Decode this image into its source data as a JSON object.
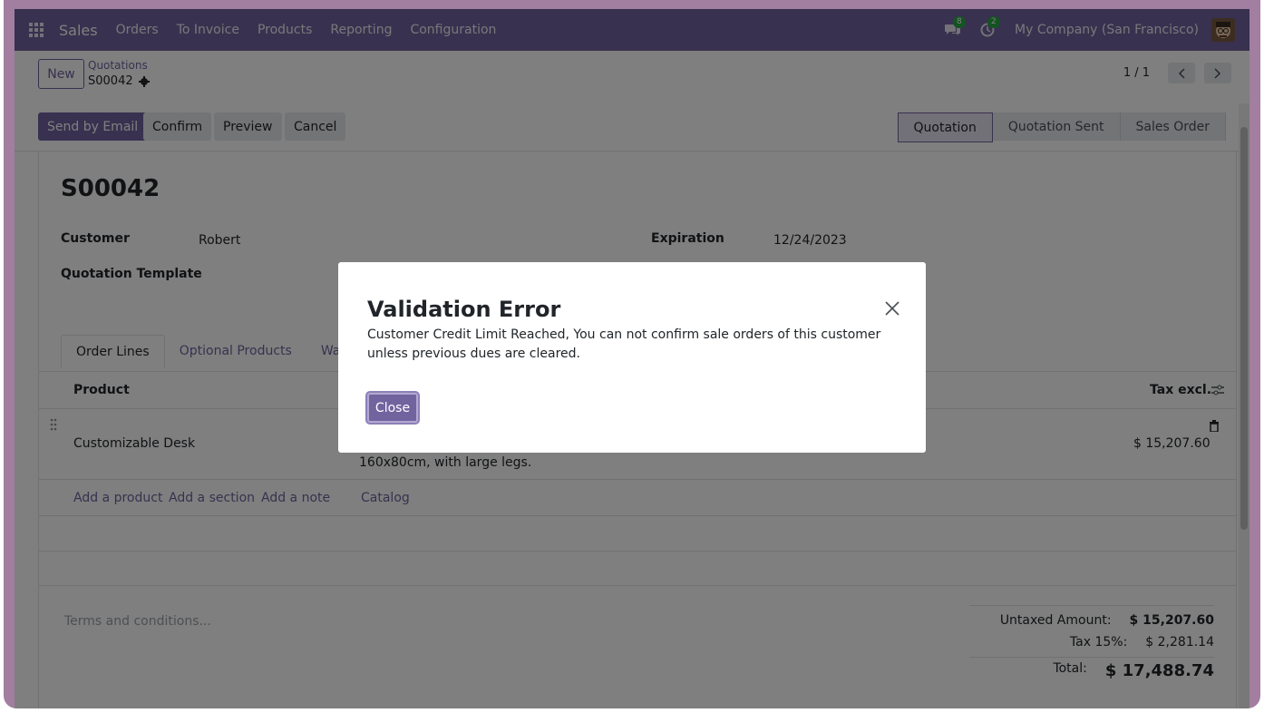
{
  "navbar": {
    "brand": "Sales",
    "menu": [
      "Orders",
      "To Invoice",
      "Products",
      "Reporting",
      "Configuration"
    ],
    "messages_count": "8",
    "activities_count": "2",
    "company": "My Company (San Francisco)"
  },
  "control_panel": {
    "new_label": "New",
    "breadcrumb": "Quotations",
    "record_name": "S00042",
    "pager_value": "1 / 1"
  },
  "statusbar": {
    "buttons": [
      "Send by Email",
      "Confirm",
      "Preview",
      "Cancel"
    ],
    "stages": [
      "Quotation",
      "Quotation Sent",
      "Sales Order"
    ],
    "active_stage": "Quotation"
  },
  "form": {
    "title": "S00042",
    "customer_label": "Customer",
    "customer_value": "Robert",
    "template_label": "Quotation Template",
    "expiration_label": "Expiration",
    "expiration_value": "12/24/2023",
    "tabs": [
      "Order Lines",
      "Optional Products",
      "Warnin"
    ],
    "columns": {
      "product": "Product",
      "tax_excl": "Tax excl."
    },
    "line": {
      "product": "Customizable Desk",
      "description": "160x80cm, with large legs.",
      "subtotal": "$ 15,207.60"
    },
    "add_links": [
      "Add a product",
      "Add a section",
      "Add a note",
      "Catalog"
    ],
    "terms_placeholder": "Terms and conditions...",
    "totals": {
      "untaxed_label": "Untaxed Amount:",
      "untaxed_value": "$ 15,207.60",
      "tax_label": "Tax 15%:",
      "tax_value": "$ 2,281.14",
      "total_label": "Total:",
      "total_value": "$ 17,488.74"
    }
  },
  "dialog": {
    "title": "Validation Error",
    "message": "Customer Credit Limit Reached, You can not confirm sale orders of this customer unless previous dues are cleared.",
    "close_label": "Close"
  },
  "colors": {
    "brand": "#71639e",
    "frame": "#a27ea0",
    "badge": "#28a745"
  }
}
